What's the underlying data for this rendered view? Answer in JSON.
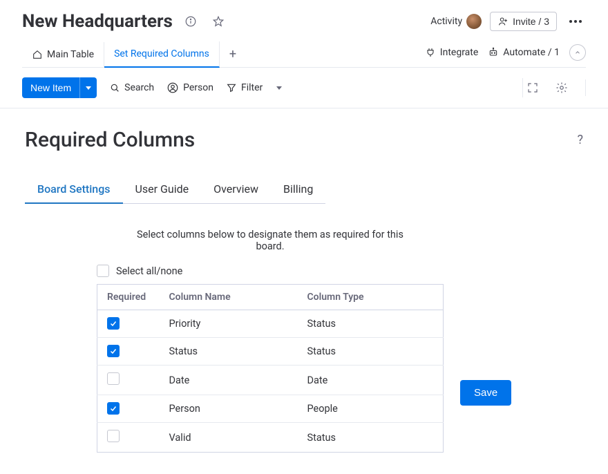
{
  "header": {
    "title": "New Headquarters",
    "activity_label": "Activity",
    "invite_label": "Invite / 3"
  },
  "tabs": {
    "items": [
      {
        "label": "Main Table",
        "active": false
      },
      {
        "label": "Set Required Columns",
        "active": true
      }
    ],
    "integrate_label": "Integrate",
    "automate_label": "Automate / 1"
  },
  "toolbar": {
    "new_item_label": "New Item",
    "search_label": "Search",
    "person_label": "Person",
    "filter_label": "Filter"
  },
  "panel": {
    "title": "Required Columns",
    "sub_tabs": [
      {
        "label": "Board Settings",
        "active": true
      },
      {
        "label": "User Guide",
        "active": false
      },
      {
        "label": "Overview",
        "active": false
      },
      {
        "label": "Billing",
        "active": false
      }
    ],
    "instruction": "Select columns below to designate them as required for this board.",
    "select_all_label": "Select all/none",
    "table_headers": {
      "required": "Required",
      "name": "Column Name",
      "type": "Column Type"
    },
    "rows": [
      {
        "checked": true,
        "name": "Priority",
        "type": "Status"
      },
      {
        "checked": true,
        "name": "Status",
        "type": "Status"
      },
      {
        "checked": false,
        "name": "Date",
        "type": "Date"
      },
      {
        "checked": true,
        "name": "Person",
        "type": "People"
      },
      {
        "checked": false,
        "name": "Valid",
        "type": "Status"
      }
    ],
    "save_label": "Save"
  }
}
